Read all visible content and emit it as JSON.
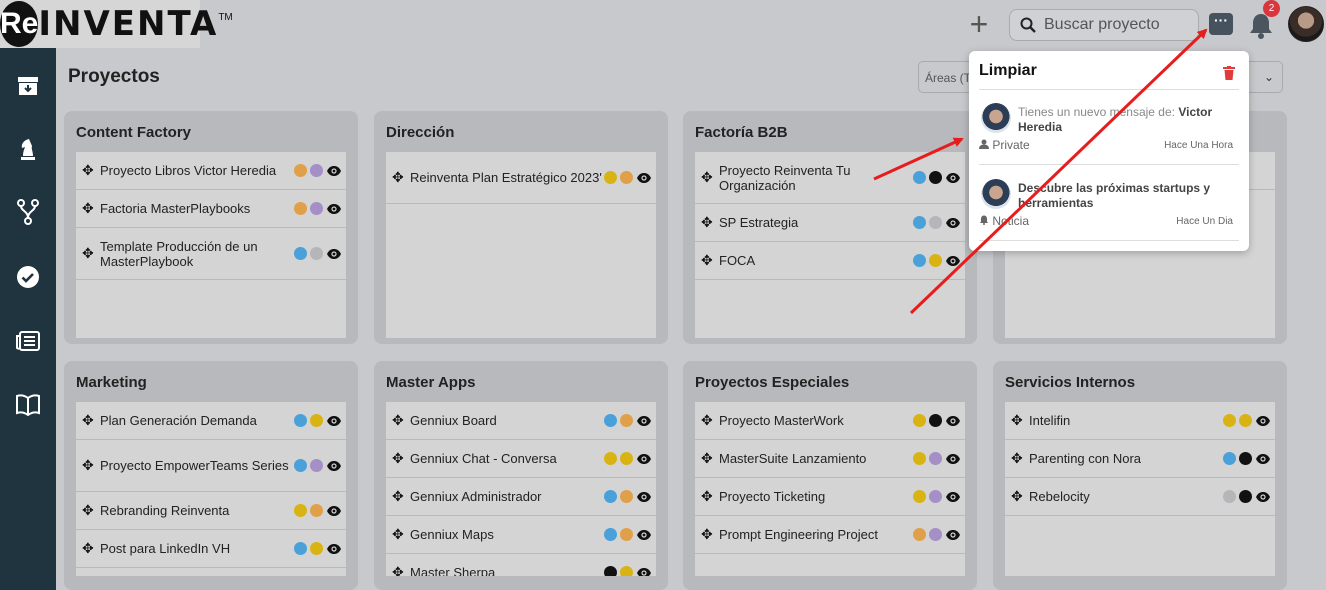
{
  "logo": {
    "circle_letters": "Re",
    "text": "INVENTA",
    "tm": "TM"
  },
  "topbar": {
    "plus_label": "+",
    "search_placeholder": "Buscar proyecto",
    "messages_label": "···",
    "notification_count": "2"
  },
  "page_title": "Proyectos",
  "areas_filter": {
    "label": "Áreas (T"
  },
  "columns": [
    {
      "title": "Content Factory",
      "items": [
        {
          "name": "Proyecto Libros Victor Heredia",
          "dots": [
            "#e0a04a",
            "#a48fc6"
          ]
        },
        {
          "name": "Factoria MasterPlaybooks",
          "dots": [
            "#e0a04a",
            "#a48fc6"
          ]
        },
        {
          "name": "Template Producción de un MasterPlaybook",
          "dots": [
            "#4aa0d8",
            "#b4b6ba"
          ]
        }
      ]
    },
    {
      "title": "Dirección",
      "items": [
        {
          "name": "Reinventa Plan Estratégico 2023'",
          "dots": [
            "#d9b314",
            "#e0a04a"
          ]
        }
      ]
    },
    {
      "title": "Factoría B2B",
      "items": [
        {
          "name": "Proyecto Reinventa Tu Organización",
          "dots": [
            "#4aa0d8",
            "#111111"
          ]
        },
        {
          "name": "SP Estrategia",
          "dots": [
            "#4aa0d8",
            "#b4b6ba"
          ]
        },
        {
          "name": "FOCA",
          "dots": [
            "#4aa0d8",
            "#d9b314"
          ]
        }
      ]
    },
    {
      "title": "",
      "items": [
        {
          "name": "",
          "dots": []
        }
      ]
    },
    {
      "title": "Marketing",
      "items": [
        {
          "name": "Plan Generación Demanda",
          "dots": [
            "#4aa0d8",
            "#d9b314"
          ]
        },
        {
          "name": "Proyecto EmpowerTeams Series",
          "dots": [
            "#4aa0d8",
            "#a48fc6"
          ]
        },
        {
          "name": "Rebranding Reinventa",
          "dots": [
            "#d9b314",
            "#e0a04a"
          ]
        },
        {
          "name": "Post para LinkedIn VH",
          "dots": [
            "#4aa0d8",
            "#d9b314"
          ]
        }
      ]
    },
    {
      "title": "Master Apps",
      "items": [
        {
          "name": "Genniux Board",
          "dots": [
            "#4aa0d8",
            "#e0a04a"
          ]
        },
        {
          "name": "Genniux Chat - Conversa",
          "dots": [
            "#d9b314",
            "#d9b314"
          ]
        },
        {
          "name": "Genniux Administrador",
          "dots": [
            "#4aa0d8",
            "#e0a04a"
          ]
        },
        {
          "name": "Genniux Maps",
          "dots": [
            "#4aa0d8",
            "#e0a04a"
          ]
        },
        {
          "name": "Master Sherpa",
          "dots": [
            "#111111",
            "#d9b314"
          ]
        }
      ]
    },
    {
      "title": "Proyectos Especiales",
      "items": [
        {
          "name": "Proyecto MasterWork",
          "dots": [
            "#d9b314",
            "#111111"
          ]
        },
        {
          "name": "MasterSuite Lanzamiento",
          "dots": [
            "#d9b314",
            "#a48fc6"
          ]
        },
        {
          "name": "Proyecto Ticketing",
          "dots": [
            "#d9b314",
            "#a48fc6"
          ]
        },
        {
          "name": "Prompt Engineering Project",
          "dots": [
            "#e0a04a",
            "#a48fc6"
          ]
        }
      ]
    },
    {
      "title": "Servicios Internos",
      "items": [
        {
          "name": "Intelifin",
          "dots": [
            "#d9b314",
            "#d9b314"
          ]
        },
        {
          "name": "Parenting con Nora",
          "dots": [
            "#4aa0d8",
            "#111111"
          ]
        },
        {
          "name": "Rebelocity",
          "dots": [
            "#b4b6ba",
            "#111111"
          ]
        }
      ]
    }
  ],
  "notifications": {
    "clear_label": "Limpiar",
    "items": [
      {
        "prefix": "Tienes un nuevo mensaje de: ",
        "bold": "Victor Heredia",
        "type": "Private",
        "time": "Hace Una Hora"
      },
      {
        "prefix": "",
        "bold": "Descubre las próximas startups y herramientas",
        "type": "Noticia",
        "time": "Hace Un Dia"
      }
    ]
  },
  "colors": {
    "sidebar": "#203440",
    "accent_red": "#e81c1c",
    "badge": "#d9363e"
  }
}
